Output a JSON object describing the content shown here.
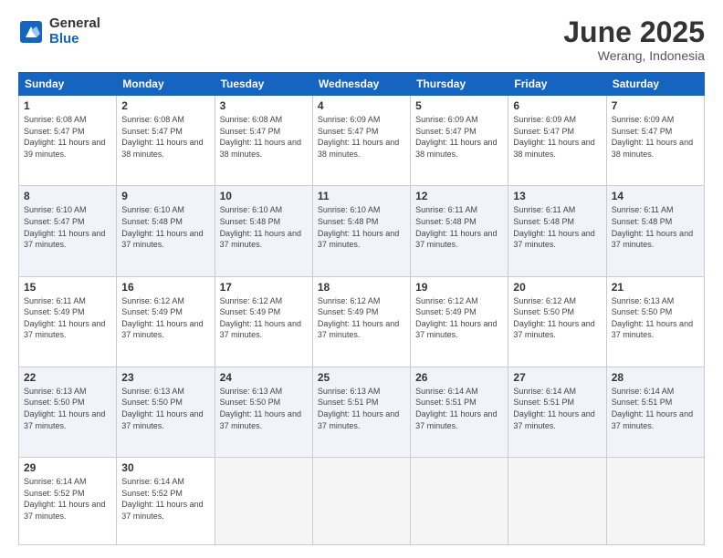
{
  "logo": {
    "general": "General",
    "blue": "Blue"
  },
  "header": {
    "month": "June 2025",
    "location": "Werang, Indonesia"
  },
  "weekdays": [
    "Sunday",
    "Monday",
    "Tuesday",
    "Wednesday",
    "Thursday",
    "Friday",
    "Saturday"
  ],
  "weeks": [
    [
      {
        "day": "1",
        "sunrise": "6:08 AM",
        "sunset": "5:47 PM",
        "daylight": "11 hours and 39 minutes."
      },
      {
        "day": "2",
        "sunrise": "6:08 AM",
        "sunset": "5:47 PM",
        "daylight": "11 hours and 38 minutes."
      },
      {
        "day": "3",
        "sunrise": "6:08 AM",
        "sunset": "5:47 PM",
        "daylight": "11 hours and 38 minutes."
      },
      {
        "day": "4",
        "sunrise": "6:09 AM",
        "sunset": "5:47 PM",
        "daylight": "11 hours and 38 minutes."
      },
      {
        "day": "5",
        "sunrise": "6:09 AM",
        "sunset": "5:47 PM",
        "daylight": "11 hours and 38 minutes."
      },
      {
        "day": "6",
        "sunrise": "6:09 AM",
        "sunset": "5:47 PM",
        "daylight": "11 hours and 38 minutes."
      },
      {
        "day": "7",
        "sunrise": "6:09 AM",
        "sunset": "5:47 PM",
        "daylight": "11 hours and 38 minutes."
      }
    ],
    [
      {
        "day": "8",
        "sunrise": "6:10 AM",
        "sunset": "5:47 PM",
        "daylight": "11 hours and 37 minutes."
      },
      {
        "day": "9",
        "sunrise": "6:10 AM",
        "sunset": "5:48 PM",
        "daylight": "11 hours and 37 minutes."
      },
      {
        "day": "10",
        "sunrise": "6:10 AM",
        "sunset": "5:48 PM",
        "daylight": "11 hours and 37 minutes."
      },
      {
        "day": "11",
        "sunrise": "6:10 AM",
        "sunset": "5:48 PM",
        "daylight": "11 hours and 37 minutes."
      },
      {
        "day": "12",
        "sunrise": "6:11 AM",
        "sunset": "5:48 PM",
        "daylight": "11 hours and 37 minutes."
      },
      {
        "day": "13",
        "sunrise": "6:11 AM",
        "sunset": "5:48 PM",
        "daylight": "11 hours and 37 minutes."
      },
      {
        "day": "14",
        "sunrise": "6:11 AM",
        "sunset": "5:48 PM",
        "daylight": "11 hours and 37 minutes."
      }
    ],
    [
      {
        "day": "15",
        "sunrise": "6:11 AM",
        "sunset": "5:49 PM",
        "daylight": "11 hours and 37 minutes."
      },
      {
        "day": "16",
        "sunrise": "6:12 AM",
        "sunset": "5:49 PM",
        "daylight": "11 hours and 37 minutes."
      },
      {
        "day": "17",
        "sunrise": "6:12 AM",
        "sunset": "5:49 PM",
        "daylight": "11 hours and 37 minutes."
      },
      {
        "day": "18",
        "sunrise": "6:12 AM",
        "sunset": "5:49 PM",
        "daylight": "11 hours and 37 minutes."
      },
      {
        "day": "19",
        "sunrise": "6:12 AM",
        "sunset": "5:49 PM",
        "daylight": "11 hours and 37 minutes."
      },
      {
        "day": "20",
        "sunrise": "6:12 AM",
        "sunset": "5:50 PM",
        "daylight": "11 hours and 37 minutes."
      },
      {
        "day": "21",
        "sunrise": "6:13 AM",
        "sunset": "5:50 PM",
        "daylight": "11 hours and 37 minutes."
      }
    ],
    [
      {
        "day": "22",
        "sunrise": "6:13 AM",
        "sunset": "5:50 PM",
        "daylight": "11 hours and 37 minutes."
      },
      {
        "day": "23",
        "sunrise": "6:13 AM",
        "sunset": "5:50 PM",
        "daylight": "11 hours and 37 minutes."
      },
      {
        "day": "24",
        "sunrise": "6:13 AM",
        "sunset": "5:50 PM",
        "daylight": "11 hours and 37 minutes."
      },
      {
        "day": "25",
        "sunrise": "6:13 AM",
        "sunset": "5:51 PM",
        "daylight": "11 hours and 37 minutes."
      },
      {
        "day": "26",
        "sunrise": "6:14 AM",
        "sunset": "5:51 PM",
        "daylight": "11 hours and 37 minutes."
      },
      {
        "day": "27",
        "sunrise": "6:14 AM",
        "sunset": "5:51 PM",
        "daylight": "11 hours and 37 minutes."
      },
      {
        "day": "28",
        "sunrise": "6:14 AM",
        "sunset": "5:51 PM",
        "daylight": "11 hours and 37 minutes."
      }
    ],
    [
      {
        "day": "29",
        "sunrise": "6:14 AM",
        "sunset": "5:52 PM",
        "daylight": "11 hours and 37 minutes."
      },
      {
        "day": "30",
        "sunrise": "6:14 AM",
        "sunset": "5:52 PM",
        "daylight": "11 hours and 37 minutes."
      },
      null,
      null,
      null,
      null,
      null
    ]
  ]
}
